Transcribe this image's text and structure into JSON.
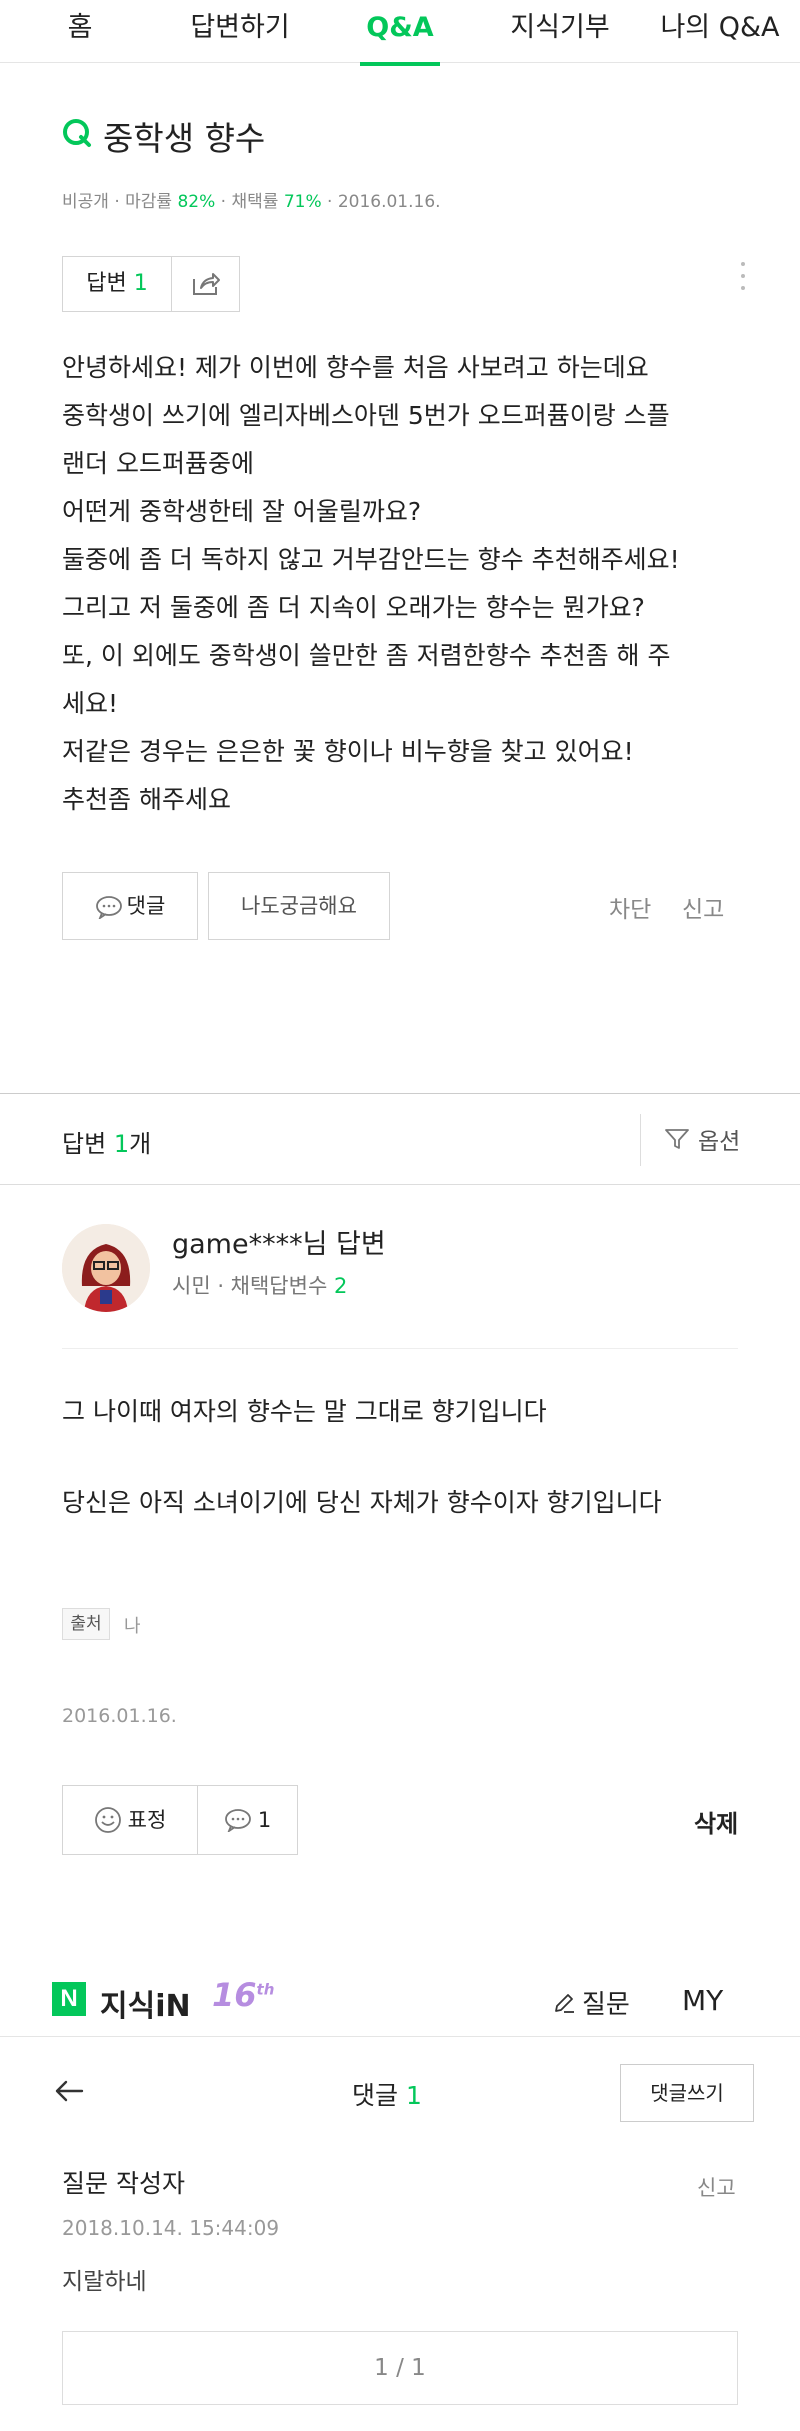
{
  "nav": {
    "tabs": [
      "홈",
      "답변하기",
      "Q&A",
      "지식기부",
      "나의 Q&A"
    ],
    "active_index": 2
  },
  "question": {
    "title": "중학생 향수",
    "meta": {
      "privacy": "비공개",
      "close_rate_label": "마감률",
      "close_rate": "82%",
      "adopt_rate_label": "채택률",
      "adopt_rate": "71%",
      "date": "2016.01.16."
    },
    "answer_label": "답변",
    "answer_count": "1",
    "body": [
      "안녕하세요! 제가 이번에 향수를 처음 사보려고 하는데요",
      "중학생이 쓰기에 엘리자베스아덴 5번가 오드퍼퓸이랑 스플",
      "랜더 오드퍼퓸중에",
      "어떤게 중학생한테 잘 어울릴까요?",
      "둘중에 좀 더 독하지 않고 거부감안드는 향수 추천해주세요!",
      "그리고 저 둘중에 좀 더 지속이 오래가는 향수는 뭔가요?",
      "또, 이 외에도 중학생이 쓸만한 좀 저렴한향수 추천좀 해 주",
      "세요!",
      "저같은 경우는 은은한 꽃 향이나 비누향을 찾고 있어요!",
      "추천좀 해주세요"
    ],
    "comment_button": "댓글",
    "curious_button": "나도궁금해요",
    "block_link": "차단",
    "report_link": "신고"
  },
  "answers_header": {
    "label": "답변",
    "count": "1",
    "suffix": "개",
    "options": "옵션"
  },
  "answer": {
    "author": "game****님 답변",
    "grade": "시민",
    "adopted_label": "채택답변수",
    "adopted_count": "2",
    "body_line1": "그 나이때 여자의 향수는 말 그대로 향기입니다",
    "body_line2": "당신은 아직 소녀이기에 당신 자체가 향수이자 향기입니다",
    "source_label": "출처",
    "source_value": "나",
    "date": "2016.01.16.",
    "expression_button": "표정",
    "comment_count": "1",
    "delete_button": "삭제"
  },
  "brand": {
    "name": "지식iN",
    "anniv": "16",
    "anniv_sup": "th",
    "ask": "질문",
    "my": "MY"
  },
  "comments": {
    "title": "댓글",
    "count": "1",
    "write_button": "댓글쓰기",
    "items": [
      {
        "writer": "질문 작성자",
        "time": "2018.10.14. 15:44:09",
        "text": "지랄하네",
        "report": "신고"
      }
    ],
    "pager": "1 / 1"
  },
  "colors": {
    "accent": "#03c75a"
  }
}
